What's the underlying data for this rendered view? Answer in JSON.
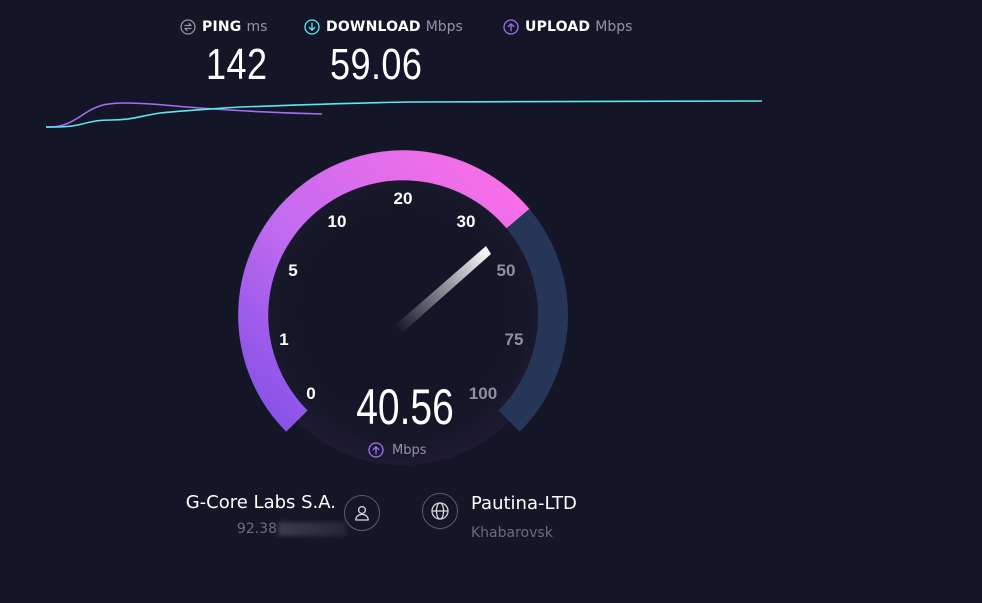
{
  "stats": {
    "ping": {
      "label": "PING",
      "unit": "ms",
      "value": "142",
      "icon": "ping-icon"
    },
    "download": {
      "label": "DOWNLOAD",
      "unit": "Mbps",
      "value": "59.06",
      "icon": "download-arrow-icon"
    },
    "upload": {
      "label": "UPLOAD",
      "unit": "Mbps",
      "icon": "upload-arrow-icon"
    }
  },
  "gauge": {
    "ticks": [
      "0",
      "1",
      "5",
      "10",
      "20",
      "30",
      "50",
      "75",
      "100"
    ],
    "current_value": "40.56",
    "current_unit": "Mbps",
    "colors": {
      "progress_start": "#8150e6",
      "progress_end": "#ff6ee6",
      "track": "#263656",
      "needle": "#ffffff"
    }
  },
  "connection": {
    "isp_name": "G-Core Labs S.A.",
    "ip_prefix": "92.38",
    "server_name": "Pautina-LTD",
    "server_location": "Khabarovsk"
  },
  "colors": {
    "background": "#141526",
    "download_line": "#5de8f0",
    "upload_line": "#a16ff5",
    "muted_text": "#9193a8"
  }
}
